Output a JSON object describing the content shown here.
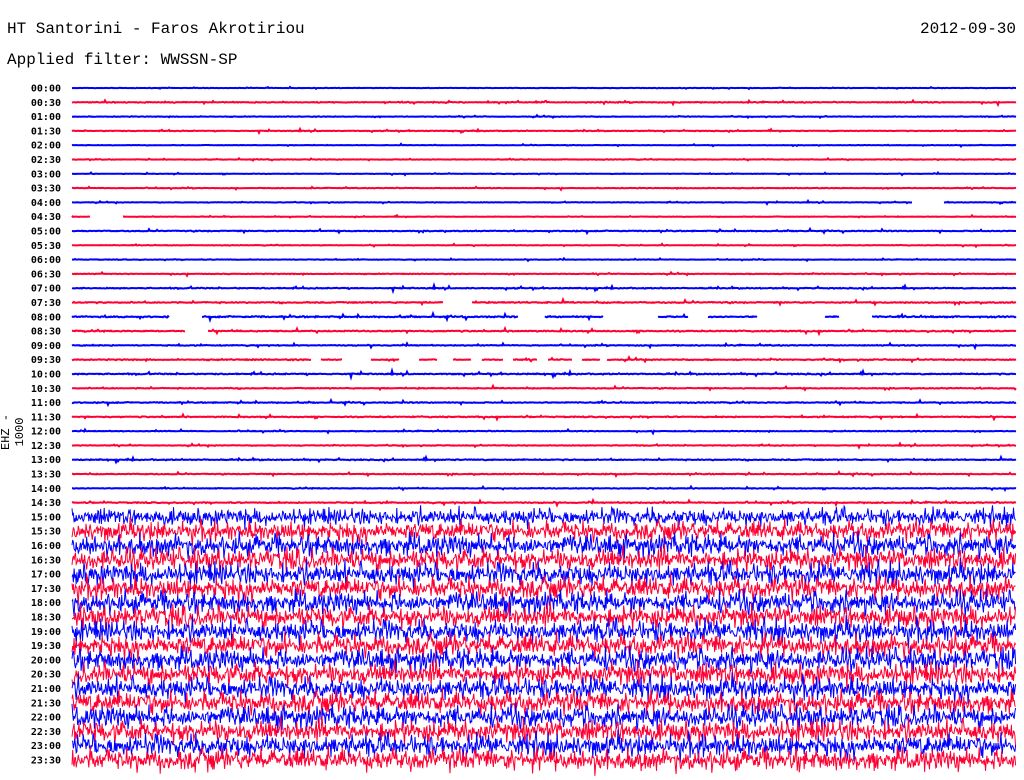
{
  "header": {
    "station": "HT Santorini - Faros Akrotiriou",
    "date": "2012-09-30",
    "filter": "Applied filter: WWSSN-SP"
  },
  "chart_data": {
    "type": "line",
    "title": "HT Santorini - Faros Akrotiriou",
    "ylabel": "EHZ - 1000",
    "minutes_per_line": 30,
    "colors": {
      "hour": "#0000ff",
      "half_hour": "#ff0033"
    },
    "rows": [
      {
        "label": "00:00",
        "amp": 0.6
      },
      {
        "label": "00:30",
        "amp": 1.2
      },
      {
        "label": "01:00",
        "amp": 0.8
      },
      {
        "label": "01:30",
        "amp": 0.9
      },
      {
        "label": "02:00",
        "amp": 0.7
      },
      {
        "label": "02:30",
        "amp": 0.7
      },
      {
        "label": "03:00",
        "amp": 0.7
      },
      {
        "label": "03:30",
        "amp": 0.8
      },
      {
        "label": "04:00",
        "amp": 0.7,
        "gaps": [
          [
            26.7,
            27.7
          ]
        ]
      },
      {
        "label": "04:30",
        "amp": 0.7,
        "gaps": [
          [
            0.6,
            1.6
          ]
        ]
      },
      {
        "label": "05:00",
        "amp": 1.2
      },
      {
        "label": "05:30",
        "amp": 0.8
      },
      {
        "label": "06:00",
        "amp": 0.7
      },
      {
        "label": "06:30",
        "amp": 0.9
      },
      {
        "label": "07:00",
        "amp": 1.3
      },
      {
        "label": "07:30",
        "amp": 1.5,
        "gaps": [
          [
            11.8,
            12.7
          ]
        ]
      },
      {
        "label": "08:00",
        "amp": 1.8,
        "gaps": [
          [
            3.1,
            4.1
          ],
          [
            14.2,
            15.0
          ],
          [
            16.9,
            18.6
          ],
          [
            19.6,
            20.2
          ],
          [
            21.8,
            23.9
          ],
          [
            24.4,
            25.4
          ]
        ]
      },
      {
        "label": "08:30",
        "amp": 1.5,
        "gaps": [
          [
            3.6,
            4.3
          ]
        ]
      },
      {
        "label": "09:00",
        "amp": 1.2
      },
      {
        "label": "09:30",
        "amp": 1.4,
        "gaps": [
          [
            7.6,
            7.9
          ],
          [
            8.6,
            9.5
          ],
          [
            10.4,
            11.0
          ],
          [
            11.6,
            12.1
          ],
          [
            12.7,
            13.0
          ],
          [
            13.7,
            14.0
          ],
          [
            14.8,
            15.1
          ],
          [
            15.9,
            16.2
          ],
          [
            16.8,
            17.0
          ]
        ]
      },
      {
        "label": "10:00",
        "amp": 1.5
      },
      {
        "label": "10:30",
        "amp": 1.2
      },
      {
        "label": "11:00",
        "amp": 1.3
      },
      {
        "label": "11:30",
        "amp": 1.3
      },
      {
        "label": "12:00",
        "amp": 1.0
      },
      {
        "label": "12:30",
        "amp": 0.9
      },
      {
        "label": "13:00",
        "amp": 1.4
      },
      {
        "label": "13:30",
        "amp": 1.1
      },
      {
        "label": "14:00",
        "amp": 1.0
      },
      {
        "label": "14:30",
        "amp": 1.4
      },
      {
        "label": "15:00",
        "amp": 14
      },
      {
        "label": "15:30",
        "amp": 16
      },
      {
        "label": "16:00",
        "amp": 18
      },
      {
        "label": "16:30",
        "amp": 18
      },
      {
        "label": "17:00",
        "amp": 18
      },
      {
        "label": "17:30",
        "amp": 18
      },
      {
        "label": "18:00",
        "amp": 18
      },
      {
        "label": "18:30",
        "amp": 18
      },
      {
        "label": "19:00",
        "amp": 18
      },
      {
        "label": "19:30",
        "amp": 18
      },
      {
        "label": "20:00",
        "amp": 18
      },
      {
        "label": "20:30",
        "amp": 18
      },
      {
        "label": "21:00",
        "amp": 18
      },
      {
        "label": "21:30",
        "amp": 18
      },
      {
        "label": "22:00",
        "amp": 18
      },
      {
        "label": "22:30",
        "amp": 18
      },
      {
        "label": "23:00",
        "amp": 18
      },
      {
        "label": "23:30",
        "amp": 18
      }
    ]
  }
}
